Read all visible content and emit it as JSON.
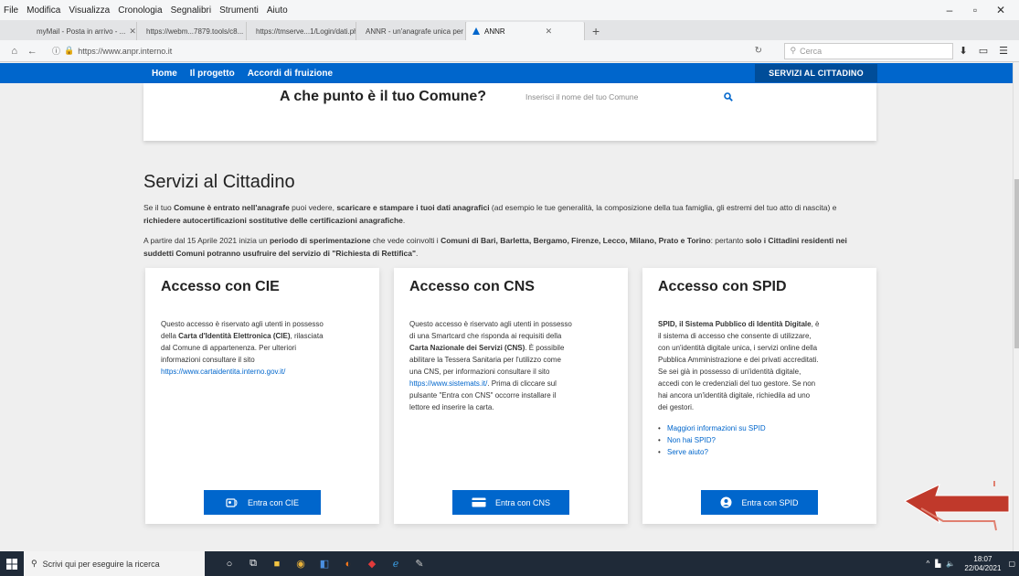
{
  "browser": {
    "menu": [
      "File",
      "Modifica",
      "Visualizza",
      "Cronologia",
      "Segnalibri",
      "Strumenti",
      "Aiuto"
    ],
    "tabs": [
      {
        "label": "myMail - Posta in arrivo - ...",
        "active": false
      },
      {
        "label": "https://webm...7879.tools/c8...",
        "active": false
      },
      {
        "label": "https://tmserve...1/Login/dati.php",
        "active": false
      },
      {
        "label": "ANNR - un'anagrafe unica per il...",
        "active": false
      },
      {
        "label": "ANNR",
        "active": true
      }
    ],
    "url": "https://www.anpr.interno.it",
    "search_placeholder": "Cerca"
  },
  "site_nav": {
    "links": [
      "Home",
      "Il progetto",
      "Accordi di fruizione"
    ],
    "cta": "SERVIZI AL CITTADINO"
  },
  "comune_search": {
    "title": "A che punto è il tuo Comune?",
    "placeholder": "Inserisci il nome del tuo Comune"
  },
  "section": {
    "title": "Servizi al Cittadino",
    "p1_a": "Se il tuo ",
    "p1_b": "Comune è entrato nell'anagrafe",
    "p1_c": " puoi vedere, ",
    "p1_d": "scaricare e stampare i tuoi dati anagrafici",
    "p1_e": " (ad esempio le tue generalità, la composizione della tua famiglia, gli estremi del tuo atto di nascita) e ",
    "p1_f": "richiedere autocertificazioni sostitutive delle certificazioni anagrafiche",
    "p1_g": ".",
    "p2_a": "A partire dal 15 Aprile 2021 inizia un ",
    "p2_b": "periodo di sperimentazione",
    "p2_c": " che vede coinvolti i ",
    "p2_d": "Comuni di Bari, Barletta, Bergamo, Firenze, Lecco, Milano, Prato e Torino",
    "p2_e": ": pertanto ",
    "p2_f": "solo i Cittadini residenti nei suddetti Comuni potranno usufruire del servizio di \"Richiesta di Rettifica\"",
    "p2_g": "."
  },
  "cards": {
    "cie": {
      "title": "Accesso con CIE",
      "l1": "Questo accesso è riservato agli utenti in possesso",
      "l2a": "della ",
      "l2b": "Carta d'Identità Elettronica (CIE)",
      "l2c": ", rilasciata",
      "l3": "dal Comune di appartenenza. Per ulteriori",
      "l4": "informazioni consultare il sito",
      "link": "https://www.cartaidentita.interno.gov.it/",
      "button": "Entra con CIE"
    },
    "cns": {
      "title": "Accesso con CNS",
      "l1": "Questo accesso è riservato agli utenti in possesso",
      "l2": "di una Smartcard che risponda ai requisiti della",
      "l3a": "Carta Nazionale dei Servizi (CNS)",
      "l3b": ". È possibile",
      "l4": "abilitare la Tessera Sanitaria per l'utilizzo come",
      "l5": "una CNS, per informazioni consultare il sito",
      "link": "https://www.sistemats.it/",
      "l6": ". Prima di cliccare sul",
      "l7": "pulsante \"Entra con CNS\" occorre installare il",
      "l8": "lettore ed inserire la carta.",
      "button": "Entra con CNS"
    },
    "spid": {
      "title": "Accesso con SPID",
      "l1a": "SPID, il Sistema Pubblico di Identità Digitale",
      "l1b": ", è",
      "l2": "il sistema di accesso che consente di utilizzare,",
      "l3": "con un'identità digitale unica, i servizi online della",
      "l4": "Pubblica Amministrazione e dei privati accreditati.",
      "l5": "Se sei già in possesso di un'identità digitale,",
      "l6": "accedi con le credenziali del tuo gestore. Se non",
      "l7": "hai ancora un'identità digitale, richiedila ad uno",
      "l8": "dei gestori.",
      "links": [
        "Maggiori informazioni su SPID",
        "Non hai SPID?",
        "Serve aiuto?"
      ],
      "button": "Entra con SPID"
    }
  },
  "taskbar": {
    "search": "Scrivi qui per eseguire la ricerca",
    "time": "18:07",
    "date": "22/04/2021"
  },
  "colors": {
    "brand_blue": "#0066cc",
    "dark_blue": "#004d99",
    "arrow_red": "#c0392b"
  }
}
